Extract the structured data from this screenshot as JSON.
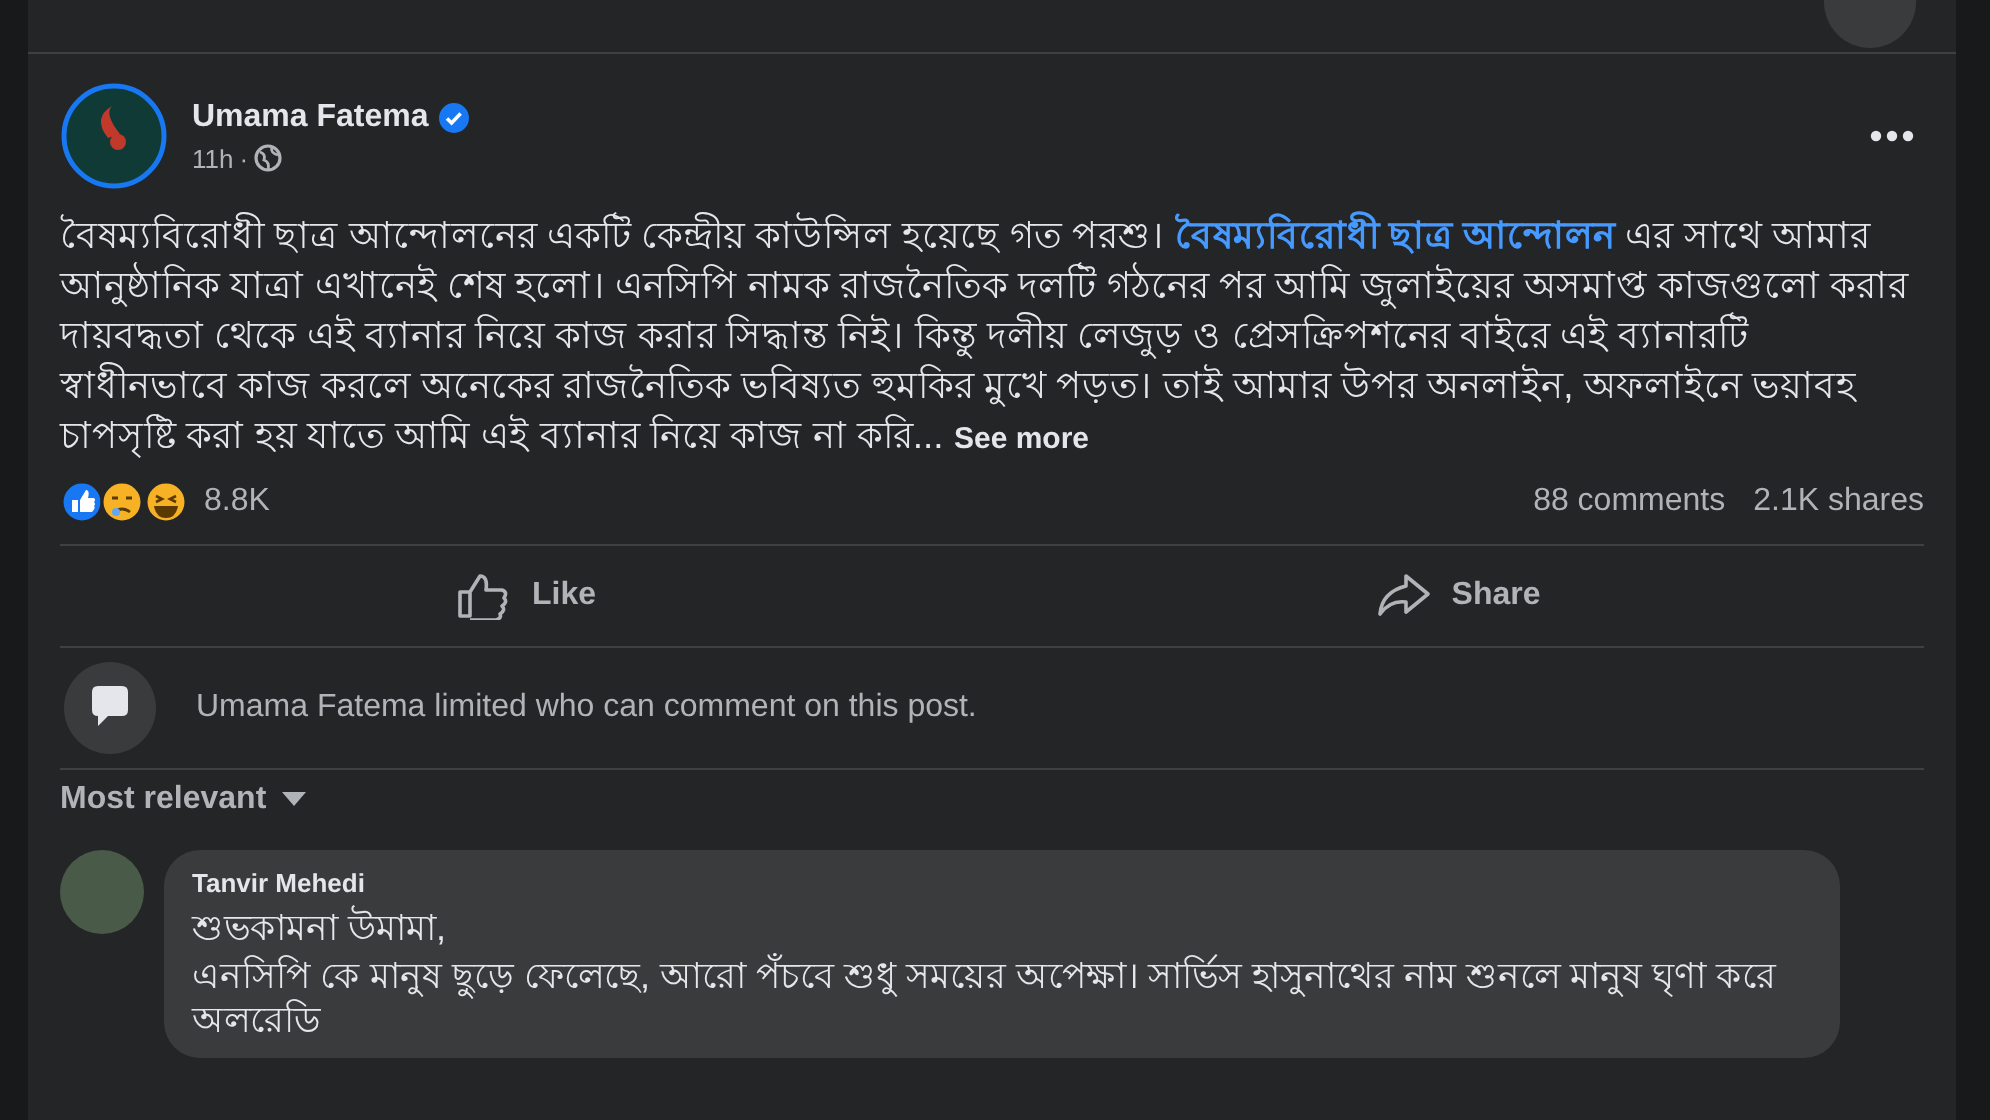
{
  "post": {
    "author": "Umama Fatema",
    "verified": true,
    "time": "11h",
    "time_separator": "·",
    "text_before": "বৈষম্যবিরোধী ছাত্র আন্দোলনের একটি কেন্দ্রীয় কাউন্সিল হয়েছে গত পরশু। ",
    "link": "বৈষম্যবিরোধী ছাত্র আন্দোলন",
    "text_after": " এর সাথে আমার আনুষ্ঠানিক যাত্রা এখানেই শেষ হলো। এনসিপি নামক রাজনৈতিক দলটি গঠনের পর আমি জুলাইয়ের অসমাপ্ত কাজগুলো করার দায়বদ্ধতা থেকে এই ব্যানার নিয়ে কাজ করার সিদ্ধান্ত নিই। কিন্তু দলীয় লেজুড় ও প্রেসক্রিপশনের বাইরে এই ব্যানারটি স্বাধীনভাবে কাজ করলে অনেকের রাজনৈতিক ভবিষ্যত হুমকির মুখে পড়ত। তাই আমার উপর অনলাইন, অফলাইনে ভয়াবহ চাপসৃষ্টি করা হয় যাতে আমি এই ব্যানার নিয়ে কাজ না করি...",
    "see_more": "See more",
    "reactions_count": "8.8K",
    "comments_count": "88 comments",
    "shares_count": "2.1K shares"
  },
  "actions": [
    {
      "kind": "like",
      "label": "Like"
    },
    {
      "kind": "share",
      "label": "Share"
    }
  ],
  "notice": "Umama Fatema limited who can comment on this post.",
  "sort": "Most relevant",
  "comments": [
    {
      "author": "Tanvir Mehedi",
      "lines": [
        "শুভকামনা উমামা,",
        "এনসিপি কে মানুষ ছুড়ে ফেলেছে, আরো পঁচবে শুধু সময়ের অপেক্ষা। সার্ভিস হাসুনাথের নাম শুনলে মানুষ ঘৃণা করে অলরেডি"
      ]
    }
  ]
}
